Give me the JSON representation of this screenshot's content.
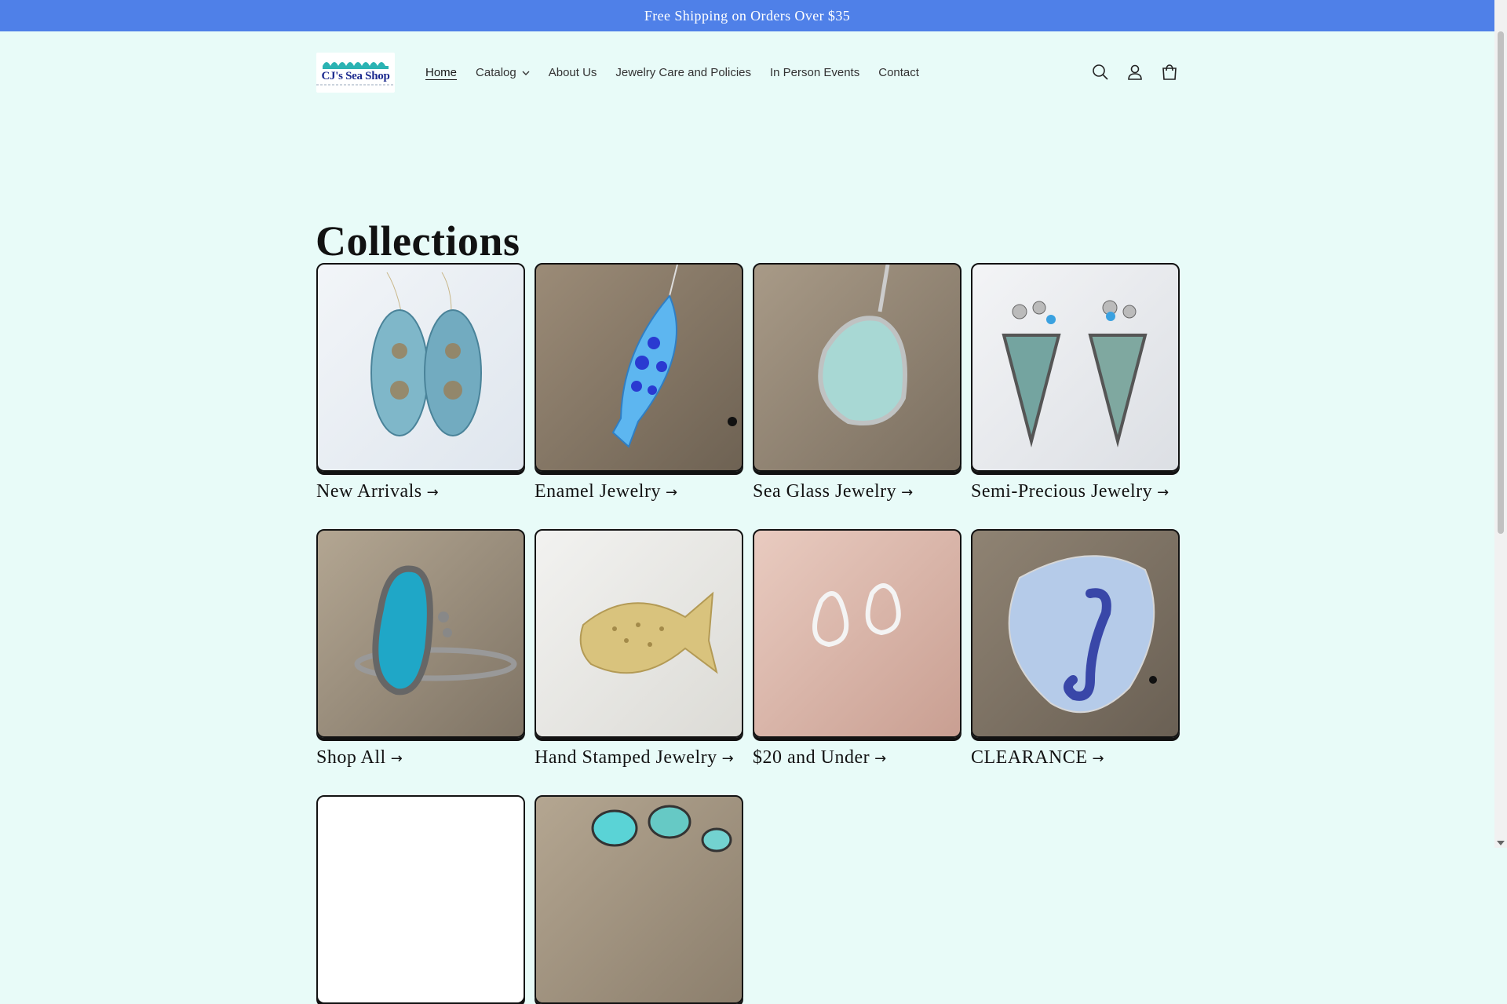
{
  "announcement": "Free Shipping on Orders Over $35",
  "brand": {
    "logo_text": "CJ's Sea Shop"
  },
  "nav": {
    "items": [
      {
        "label": "Home",
        "active": true
      },
      {
        "label": "Catalog",
        "dropdown": true
      },
      {
        "label": "About Us"
      },
      {
        "label": "Jewelry Care and Policies"
      },
      {
        "label": "In Person Events"
      },
      {
        "label": "Contact"
      }
    ]
  },
  "header_icons": [
    "search-icon",
    "account-icon",
    "cart-icon"
  ],
  "page": {
    "title": "Collections"
  },
  "collections": [
    {
      "label": "New Arrivals",
      "image": "enamel-teardrop-earrings"
    },
    {
      "label": "Enamel Jewelry",
      "image": "blue-enamel-fish-pendant"
    },
    {
      "label": "Sea Glass Jewelry",
      "image": "sea-glass-pendant"
    },
    {
      "label": "Semi-Precious Jewelry",
      "image": "turquoise-stone-earrings"
    },
    {
      "label": "Shop All",
      "image": "turquoise-ring"
    },
    {
      "label": "Hand Stamped Jewelry",
      "image": "gold-fish-ring"
    },
    {
      "label": "$20 and Under",
      "image": "teardrop-stud-earrings"
    },
    {
      "label": "CLEARANCE",
      "image": "seahorse-enamel-pendant"
    },
    {
      "label": "",
      "image": "blank"
    },
    {
      "label": "",
      "image": "turquoise-cabochons"
    }
  ],
  "colors": {
    "announcement_bg": "#4f80e8",
    "page_bg": "#e8fbf8",
    "text": "#121212"
  }
}
